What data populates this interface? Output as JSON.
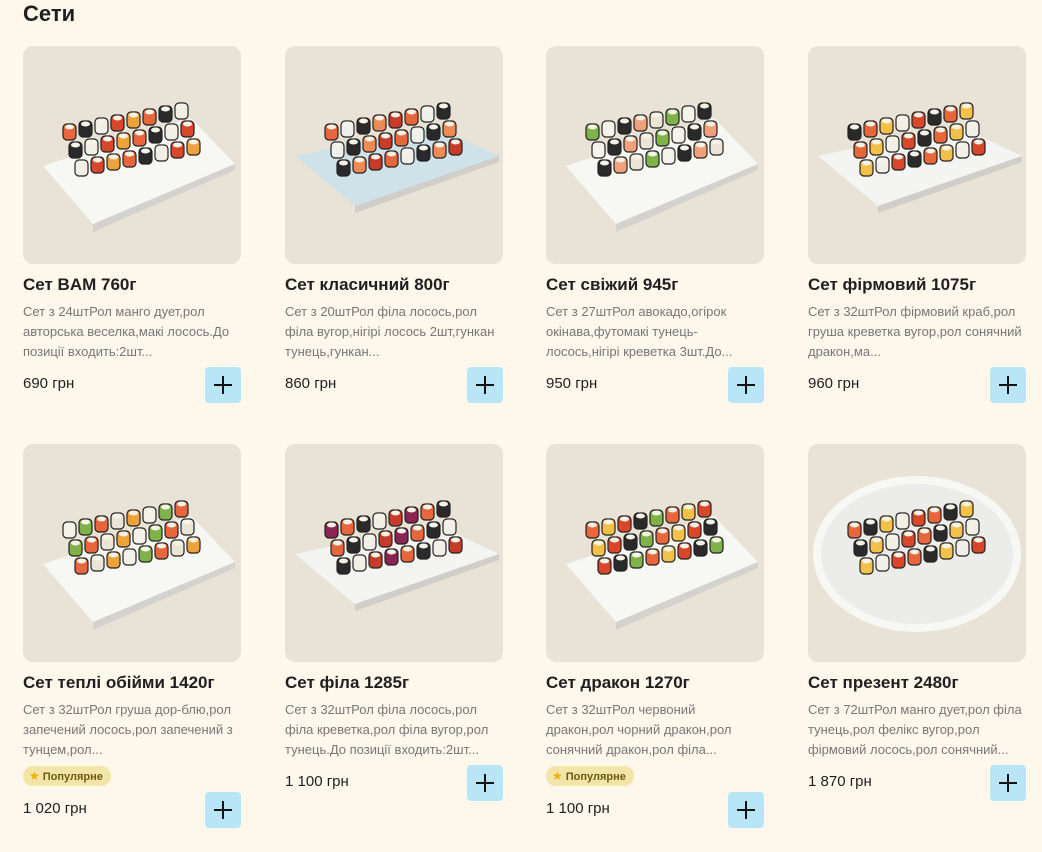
{
  "section": {
    "title": "Сети"
  },
  "items": [
    {
      "name": "Сет BAM 760г",
      "desc": "Сет з 24штРол манго дует,рол авторська веселка,макі лосось.До позиції входить:2шт...",
      "price": "690 грн",
      "badge": "",
      "image": "sushi-set-photo"
    },
    {
      "name": "Сет класичний 800г",
      "desc": "Сет з 20штРол філа лосось,рол філа вугор,нігірі лосось 2шт,гункан тунець,гункан...",
      "price": "860 грн",
      "badge": "",
      "image": "sushi-set-photo"
    },
    {
      "name": "Сет свіжий 945г",
      "desc": "Сет з 27штРол авокадо,огірок окінава,футомакі тунець-лосось,нігірі креветка 3шт.До...",
      "price": "950 грн",
      "badge": "",
      "image": "sushi-set-photo"
    },
    {
      "name": "Сет фірмовий 1075г",
      "desc": "Сет з 32штРол фірмовий краб,рол груша креветка вугор,рол сонячний дракон,ма...",
      "price": "960 грн",
      "badge": "",
      "image": "sushi-set-photo"
    },
    {
      "name": "Сет теплі обійми 1420г",
      "desc": "Сет з 32штРол груша дор-блю,рол запечений лосось,рол запечений з тунцем,рол...",
      "price": "1 020 грн",
      "badge": "Популярне",
      "image": "sushi-set-photo"
    },
    {
      "name": "Сет філа 1285г",
      "desc": "Сет з 32штРол філа лосось,рол філа креветка,рол філа вугор,рол тунець.До позиції входить:2шт...",
      "price": "1 100 грн",
      "badge": "",
      "image": "sushi-set-photo"
    },
    {
      "name": "Сет дракон 1270г",
      "desc": "Сет з 32штРол червоний дракон,рол чорний дракон,рол сонячний дракон,рол філа...",
      "price": "1 100 грн",
      "badge": "Популярне",
      "image": "sushi-set-photo"
    },
    {
      "name": "Сет презент 2480г",
      "desc": "Сет з 72штРол манго дует,рол філа тунець,рол фелікс вугор,рол фірмовий лосось,рол сонячний...",
      "price": "1 870 грн",
      "badge": "",
      "image": "sushi-set-photo"
    }
  ],
  "icons": {
    "add": "plus-icon",
    "badge": "star-icon"
  },
  "colors": {
    "background": "#fdf7ec",
    "add_button": "#b9e6f7",
    "badge_bg": "#f3e4a8",
    "photo_bg": "#e8e3d6"
  }
}
